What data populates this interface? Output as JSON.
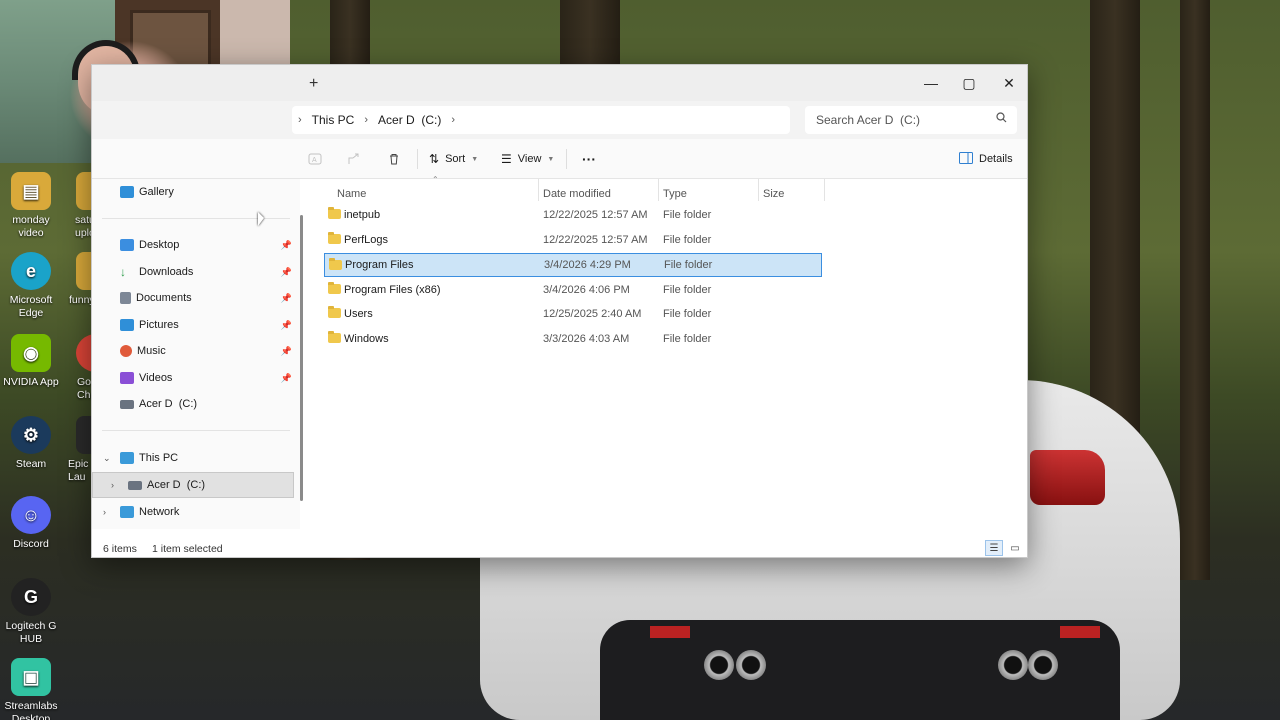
{
  "explorer": {
    "new_tab": "+",
    "window_controls": {
      "minimize": "—",
      "maximize": "▢",
      "close": "✕"
    },
    "breadcrumb": [
      "This PC",
      "Acer D  (C:)"
    ],
    "breadcrumb_sep": "›",
    "search_placeholder": "Search Acer D  (C:)",
    "toolbar": {
      "sort": "Sort",
      "view": "View",
      "more": "···",
      "details": "Details"
    },
    "nav": {
      "gallery": "Gallery",
      "quick_access": [
        {
          "label": "Desktop",
          "color": "#3b8ee0"
        },
        {
          "label": "Downloads",
          "color": "#2e9c4b"
        },
        {
          "label": "Documents",
          "color": "#7d8796"
        },
        {
          "label": "Pictures",
          "color": "#2f8fd8"
        },
        {
          "label": "Music",
          "color": "#e05a3a"
        },
        {
          "label": "Videos",
          "color": "#8a4fd6"
        },
        {
          "label": "Acer D  (C:)",
          "color": "#6a7380"
        }
      ],
      "this_pc": "This PC",
      "drive": "Acer D  (C:)",
      "network": "Network"
    },
    "columns": {
      "name": "Name",
      "date": "Date modified",
      "type": "Type",
      "size": "Size"
    },
    "files": [
      {
        "name": "inetpub",
        "date": "12/22/2025 12:57 AM",
        "type": "File folder",
        "selected": false
      },
      {
        "name": "PerfLogs",
        "date": "12/22/2025 12:57 AM",
        "type": "File folder",
        "selected": false
      },
      {
        "name": "Program Files",
        "date": "3/4/2026 4:29 PM",
        "type": "File folder",
        "selected": true
      },
      {
        "name": "Program Files (x86)",
        "date": "3/4/2026 4:06 PM",
        "type": "File folder",
        "selected": false
      },
      {
        "name": "Users",
        "date": "12/25/2025 2:40 AM",
        "type": "File folder",
        "selected": false
      },
      {
        "name": "Windows",
        "date": "3/3/2026 4:03 AM",
        "type": "File folder",
        "selected": false
      }
    ],
    "status": {
      "items": "6 items",
      "selected": "1 item selected"
    }
  },
  "desktop": {
    "icons": [
      {
        "label": "monday video",
        "color": "#d9a93a",
        "glyph": "▤"
      },
      {
        "label": "Microsoft Edge",
        "color": "#1aa3c9",
        "glyph": "e"
      },
      {
        "label": "NVIDIA App",
        "color": "#76b900",
        "glyph": "◉"
      },
      {
        "label": "Steam",
        "color": "#1b3a5c",
        "glyph": "⚙"
      },
      {
        "label": "Discord",
        "color": "#5865f2",
        "glyph": "☺"
      },
      {
        "label": "Logitech G HUB",
        "color": "#222222",
        "glyph": "G"
      },
      {
        "label": "Streamlabs Desktop",
        "color": "#31c3a2",
        "glyph": "▣"
      }
    ],
    "partial_icons": [
      {
        "label": "satu uplo",
        "color": "#d9a93a"
      },
      {
        "label": "funny",
        "color": "#d9a93a"
      },
      {
        "label": "Go Chr",
        "color": "#db4437"
      },
      {
        "label": "Epic Lau",
        "color": "#2a2a2a"
      }
    ]
  }
}
